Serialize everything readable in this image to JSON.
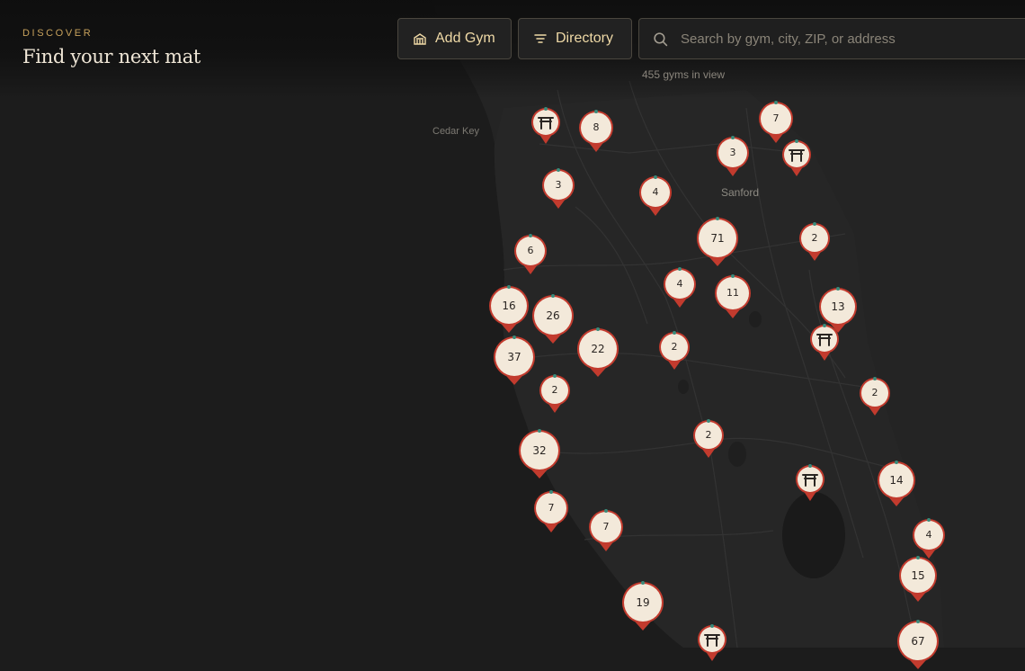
{
  "header": {
    "eyebrow": "DISCOVER",
    "title": "Find your next mat"
  },
  "toolbar": {
    "add_gym_label": "Add Gym",
    "directory_label": "Directory"
  },
  "search": {
    "placeholder": "Search by gym, city, ZIP, or address"
  },
  "status": {
    "gym_count": "455 gyms in view"
  },
  "map": {
    "places": [
      "Cedar Key",
      "Sanford"
    ],
    "clusters": [
      "8",
      "7",
      "3",
      "3",
      "4",
      "71",
      "2",
      "6",
      "4",
      "11",
      "16",
      "26",
      "13",
      "22",
      "2",
      "37",
      "2",
      "2",
      "2",
      "32",
      "14",
      "7",
      "7",
      "4",
      "15",
      "19",
      "67"
    ],
    "single_gym_icon": "torii-gate-icon",
    "colors": {
      "pin_fill": "#f3e9da",
      "pin_ring": "#c23b2e",
      "background": "#1c1c1c",
      "accent": "#c8a25c"
    }
  }
}
